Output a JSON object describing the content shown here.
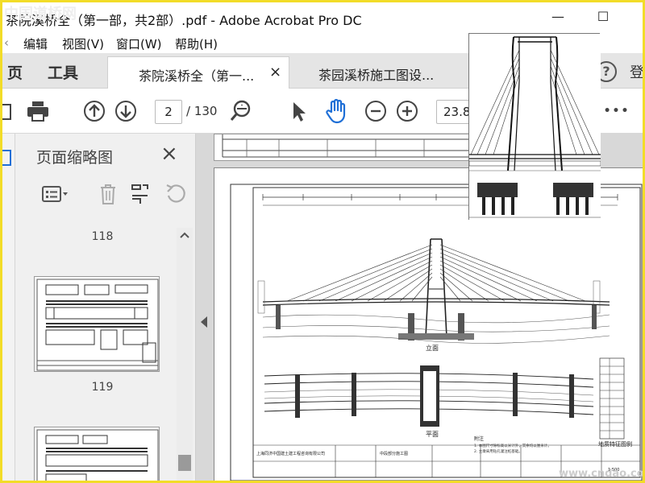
{
  "window": {
    "title": "茶院溪桥全（第一部，共2部）.pdf - Adobe Acrobat Pro DC",
    "minimize_label": "—",
    "maximize_label": "☐"
  },
  "menu": [
    "编辑",
    "视图(V)",
    "窗口(W)",
    "帮助(H)"
  ],
  "menu_partial_left": "‹",
  "tabs": {
    "home_partial": "页",
    "tools": "工具",
    "doc1": "茶院溪桥全（第一...",
    "doc1_close": "×",
    "doc2": "茶园溪桥施工图设..."
  },
  "header_right": {
    "help": "?",
    "login_partial": "登"
  },
  "toolbar": {
    "page_current": "2",
    "page_total": "/ 130",
    "zoom_value": "23.8",
    "more": "•••"
  },
  "thumbnail_panel": {
    "title": "页面缩略图",
    "close": "×",
    "pages": [
      "118",
      "119"
    ]
  },
  "watermark_top": "中国道桥网",
  "watermark_bottom": "www.cndao.com",
  "drawing": {
    "company": "上海同济中国建土建工程咨询有限公司",
    "section_elevation": "立面",
    "section_plan": "平面",
    "legend_title": "地质特征图例",
    "note_title": "附注",
    "notes": [
      "1. 本图尺寸除标高以米计外，其余均以厘米计。",
      "2. 主墩采用钻孔灌注桩基础。"
    ],
    "title_block": "中段部分施工图",
    "bottom_note": "1:500"
  },
  "colors": {
    "accent_blue": "#1f6fd6",
    "frame_yellow": "#f2dc28"
  }
}
